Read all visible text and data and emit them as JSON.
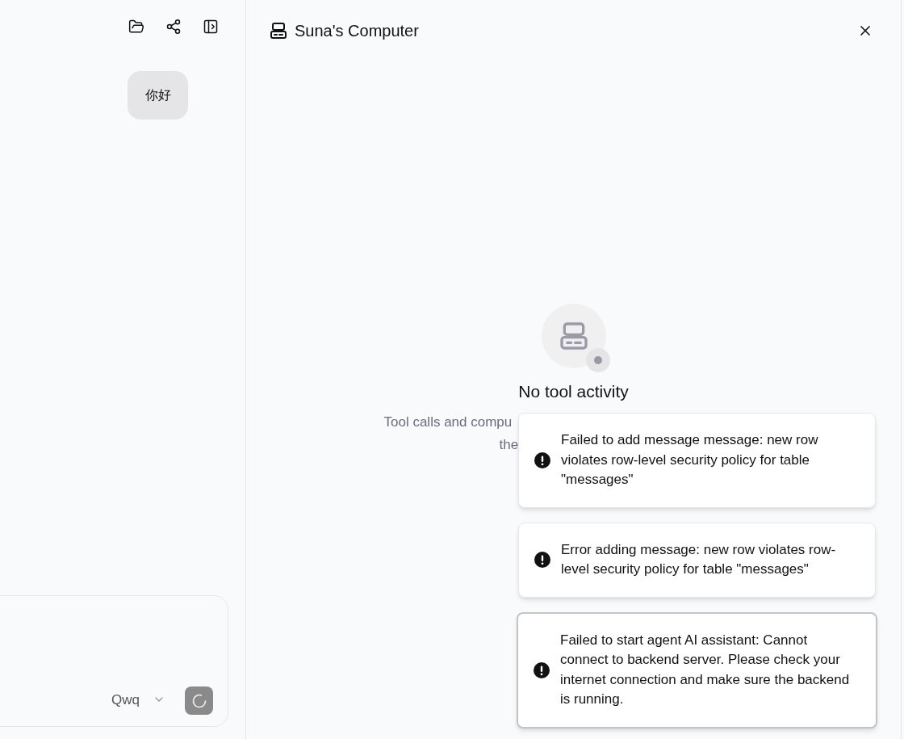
{
  "chat": {
    "messages": [
      {
        "text": "你好"
      }
    ],
    "model": "Qwq"
  },
  "computer_panel": {
    "title": "Suna's Computer",
    "empty_state": {
      "heading": "No tool activity",
      "subtitle_lines": [
        "Tool calls and compu",
        "the"
      ]
    }
  },
  "toasts": [
    {
      "text": "Failed to add message message: new row violates row-level security policy for table \"messages\"",
      "focused": false
    },
    {
      "text": "Error adding message: new row violates row-level security policy for table \"messages\"",
      "focused": false
    },
    {
      "text": "Failed to start agent AI assistant: Cannot connect to backend server. Please check your internet connection and make sure the backend is running.",
      "focused": true
    }
  ]
}
